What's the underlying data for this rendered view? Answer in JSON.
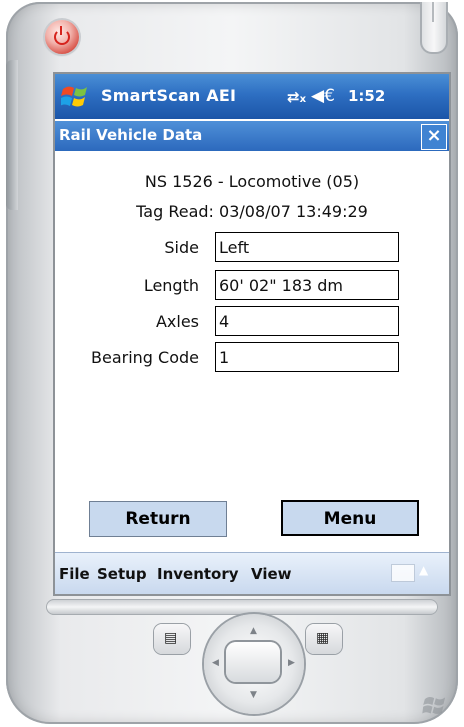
{
  "status_bar": {
    "app_title": "SmartScan AEI",
    "time": "1:52",
    "connectivity_icon": "connectivity-icon",
    "volume_icon": "volume-icon"
  },
  "form": {
    "title": "Rail Vehicle Data",
    "close_label": "×"
  },
  "vehicle": {
    "header": "NS   1526 - Locomotive (05)",
    "tag_read": "Tag Read: 03/08/07 13:49:29"
  },
  "fields": {
    "side": {
      "label": "Side",
      "value": "Left"
    },
    "length": {
      "label": "Length",
      "value": "60' 02\"  183 dm"
    },
    "axles": {
      "label": "Axles",
      "value": "4"
    },
    "bearing_code": {
      "label": "Bearing Code",
      "value": "1"
    }
  },
  "buttons": {
    "return_label": "Return",
    "menu_label": "Menu"
  },
  "menubar": {
    "items": [
      "File",
      "Setup",
      "Inventory",
      "View"
    ]
  },
  "colors": {
    "title_bar": "#2e6fc2",
    "button_fill": "#c8d9ee",
    "power_button": "#d8544a"
  }
}
